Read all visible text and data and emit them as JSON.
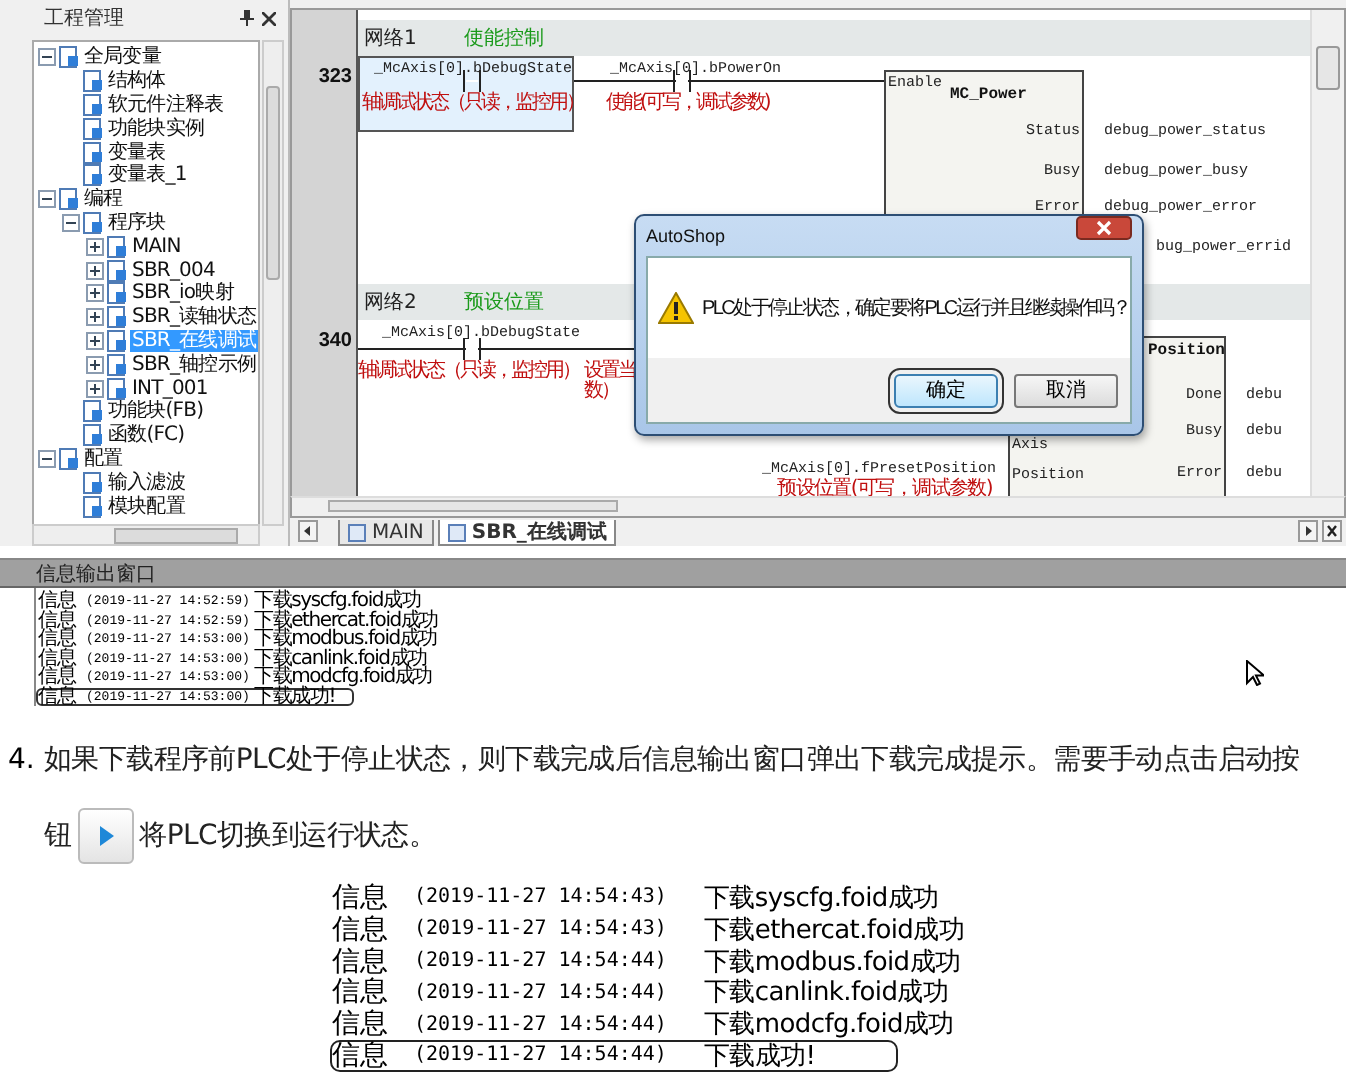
{
  "project_panel": {
    "title": "工程管理",
    "tree": [
      {
        "label": "全局变量",
        "expanded": true,
        "selected": false,
        "children": [
          {
            "label": "结构体",
            "selected": false
          },
          {
            "label": "软元件注释表",
            "selected": false
          },
          {
            "label": "功能块实例",
            "selected": false
          },
          {
            "label": "变量表",
            "selected": false
          },
          {
            "label": "变量表_1",
            "selected": false
          }
        ]
      },
      {
        "label": "编程",
        "expanded": true,
        "selected": false,
        "children": [
          {
            "label": "程序块",
            "expanded": true,
            "selected": false,
            "children": [
              {
                "label": "MAIN",
                "expanded": false,
                "selected": false
              },
              {
                "label": "SBR_004",
                "expanded": false,
                "selected": false
              },
              {
                "label": "SBR_io映射",
                "expanded": false,
                "selected": false
              },
              {
                "label": "SBR_读轴状态",
                "expanded": false,
                "selected": false
              },
              {
                "label": "SBR_在线调试",
                "expanded": false,
                "selected": true
              },
              {
                "label": "SBR_轴控示例",
                "expanded": false,
                "selected": false
              },
              {
                "label": "INT_001",
                "expanded": false,
                "selected": false
              }
            ]
          },
          {
            "label": "功能块(FB)",
            "selected": false
          },
          {
            "label": "函数(FC)",
            "selected": false
          }
        ]
      },
      {
        "label": "配置",
        "expanded": true,
        "selected": false,
        "children": [
          {
            "label": "输入滤波",
            "selected": false
          },
          {
            "label": "模块配置",
            "selected": false
          }
        ]
      }
    ]
  },
  "editor": {
    "networks": [
      {
        "title": "网络1",
        "comment": "使能控制",
        "row_number": "323",
        "contacts": [
          {
            "variable": "_McAxis[0].bDebugState",
            "comment": [
              "轴调试状态（只读，监控用）"
            ],
            "selected": true
          },
          {
            "variable": "_McAxis[0].bPowerOn",
            "comment": [
              "使能(可写，调试参数)"
            ],
            "selected": false
          }
        ],
        "block": {
          "name": "MC_Power",
          "inputs": [
            {
              "pin": "Enable"
            }
          ],
          "outputs": [
            {
              "pin": "Status",
              "variable": "debug_power_status"
            },
            {
              "pin": "Busy",
              "variable": "debug_power_busy"
            },
            {
              "pin": "Error",
              "variable": "debug_power_error"
            },
            {
              "variable": "bug_power_errid"
            }
          ]
        }
      },
      {
        "title": "网络2",
        "comment": "预设位置",
        "row_number": "340",
        "contacts": [
          {
            "variable": "_McAxis[0].bDebugState",
            "comment": [
              "轴调试状态（只读，监控用）"
            ],
            "selected": false
          },
          {
            "comment": [
              "设置当",
              "数）"
            ],
            "selected": false
          }
        ],
        "block": {
          "name": "Position",
          "inputs": [
            {
              "pin": "Axis"
            },
            {
              "pin": "Position",
              "variable": "_McAxis[0].fPresetPosition",
              "comment": "预设位置(可写，调试参数)"
            }
          ],
          "outputs": [
            {
              "pin": "Done",
              "variable": "debu"
            },
            {
              "pin": "Busy",
              "variable": "debu"
            },
            {
              "pin": "Error",
              "variable": "debu"
            }
          ]
        }
      }
    ],
    "tabs": [
      {
        "label": "MAIN",
        "selected": false
      },
      {
        "label": "SBR_在线调试",
        "selected": true
      }
    ]
  },
  "dialog": {
    "title": "AutoShop",
    "message": "PLC处于停止状态，确定要将PLC运行并且继续操作吗？",
    "buttons": [
      {
        "label": "确定",
        "default": true
      },
      {
        "label": "取消",
        "default": false
      }
    ]
  },
  "output_window": {
    "title": "信息输出窗口",
    "lines": [
      {
        "level": "信息",
        "time": "(2019-11-27 14:52:59)",
        "message": "下载syscfg.foid成功",
        "boxed": false
      },
      {
        "level": "信息",
        "time": "(2019-11-27 14:52:59)",
        "message": "下载ethercat.foid成功",
        "boxed": false
      },
      {
        "level": "信息",
        "time": "(2019-11-27 14:53:00)",
        "message": "下载modbus.foid成功",
        "boxed": false
      },
      {
        "level": "信息",
        "time": "(2019-11-27 14:53:00)",
        "message": "下载canlink.foid成功",
        "boxed": false
      },
      {
        "level": "信息",
        "time": "(2019-11-27 14:53:00)",
        "message": "下载modcfg.foid成功",
        "boxed": false
      },
      {
        "level": "信息",
        "time": "(2019-11-27 14:53:00)",
        "message": "下载成功!",
        "boxed": true
      }
    ]
  },
  "instruction": {
    "number": "4.",
    "text_before": "如果下载程序前PLC处于停止状态，则下载完成后信息输出窗口弹出下载完成提示。需要手动点击启动按钮",
    "text_after": "将PLC切换到运行状态。"
  },
  "log_excerpt": {
    "lines": [
      {
        "level": "信息",
        "time": "(2019-11-27 14:54:43)",
        "message": "下载syscfg.foid成功",
        "boxed": false
      },
      {
        "level": "信息",
        "time": "(2019-11-27 14:54:43)",
        "message": "下载ethercat.foid成功",
        "boxed": false
      },
      {
        "level": "信息",
        "time": "(2019-11-27 14:54:44)",
        "message": "下载modbus.foid成功",
        "boxed": false
      },
      {
        "level": "信息",
        "time": "(2019-11-27 14:54:44)",
        "message": "下载canlink.foid成功",
        "boxed": false
      },
      {
        "level": "信息",
        "time": "(2019-11-27 14:54:44)",
        "message": "下载modcfg.foid成功",
        "boxed": false
      },
      {
        "level": "信息",
        "time": "(2019-11-27 14:54:44)",
        "message": "下载成功!",
        "boxed": true
      }
    ]
  }
}
